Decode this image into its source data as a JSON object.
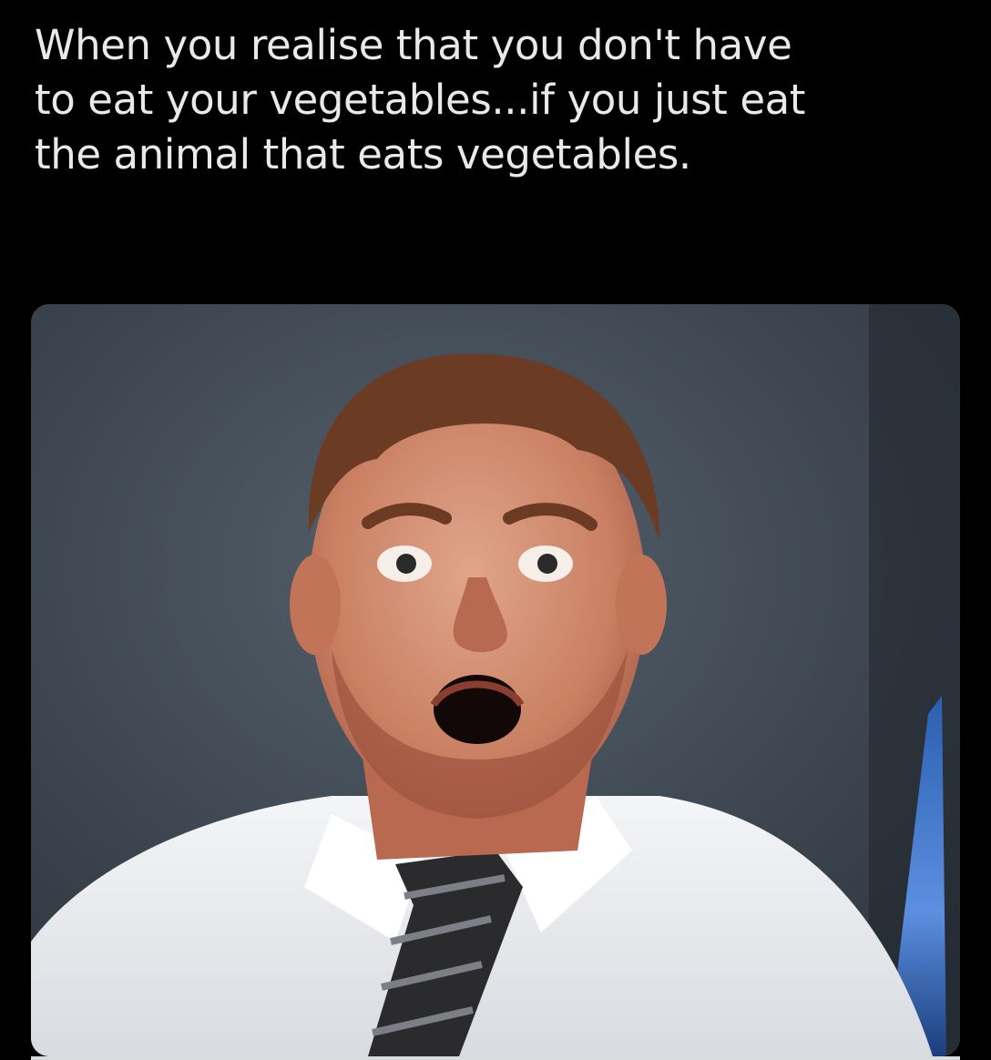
{
  "post": {
    "text_lines": [
      "When you realise that you don't have",
      "to eat your vegetables...if you just eat",
      "the animal that eats vegetables."
    ]
  },
  "media": {
    "icon": "photo-icon",
    "subject": "surprised-man-photo"
  },
  "colors": {
    "background": "#000000",
    "text": "#e7e9ea",
    "photo_backdrop": "#3f4852"
  }
}
